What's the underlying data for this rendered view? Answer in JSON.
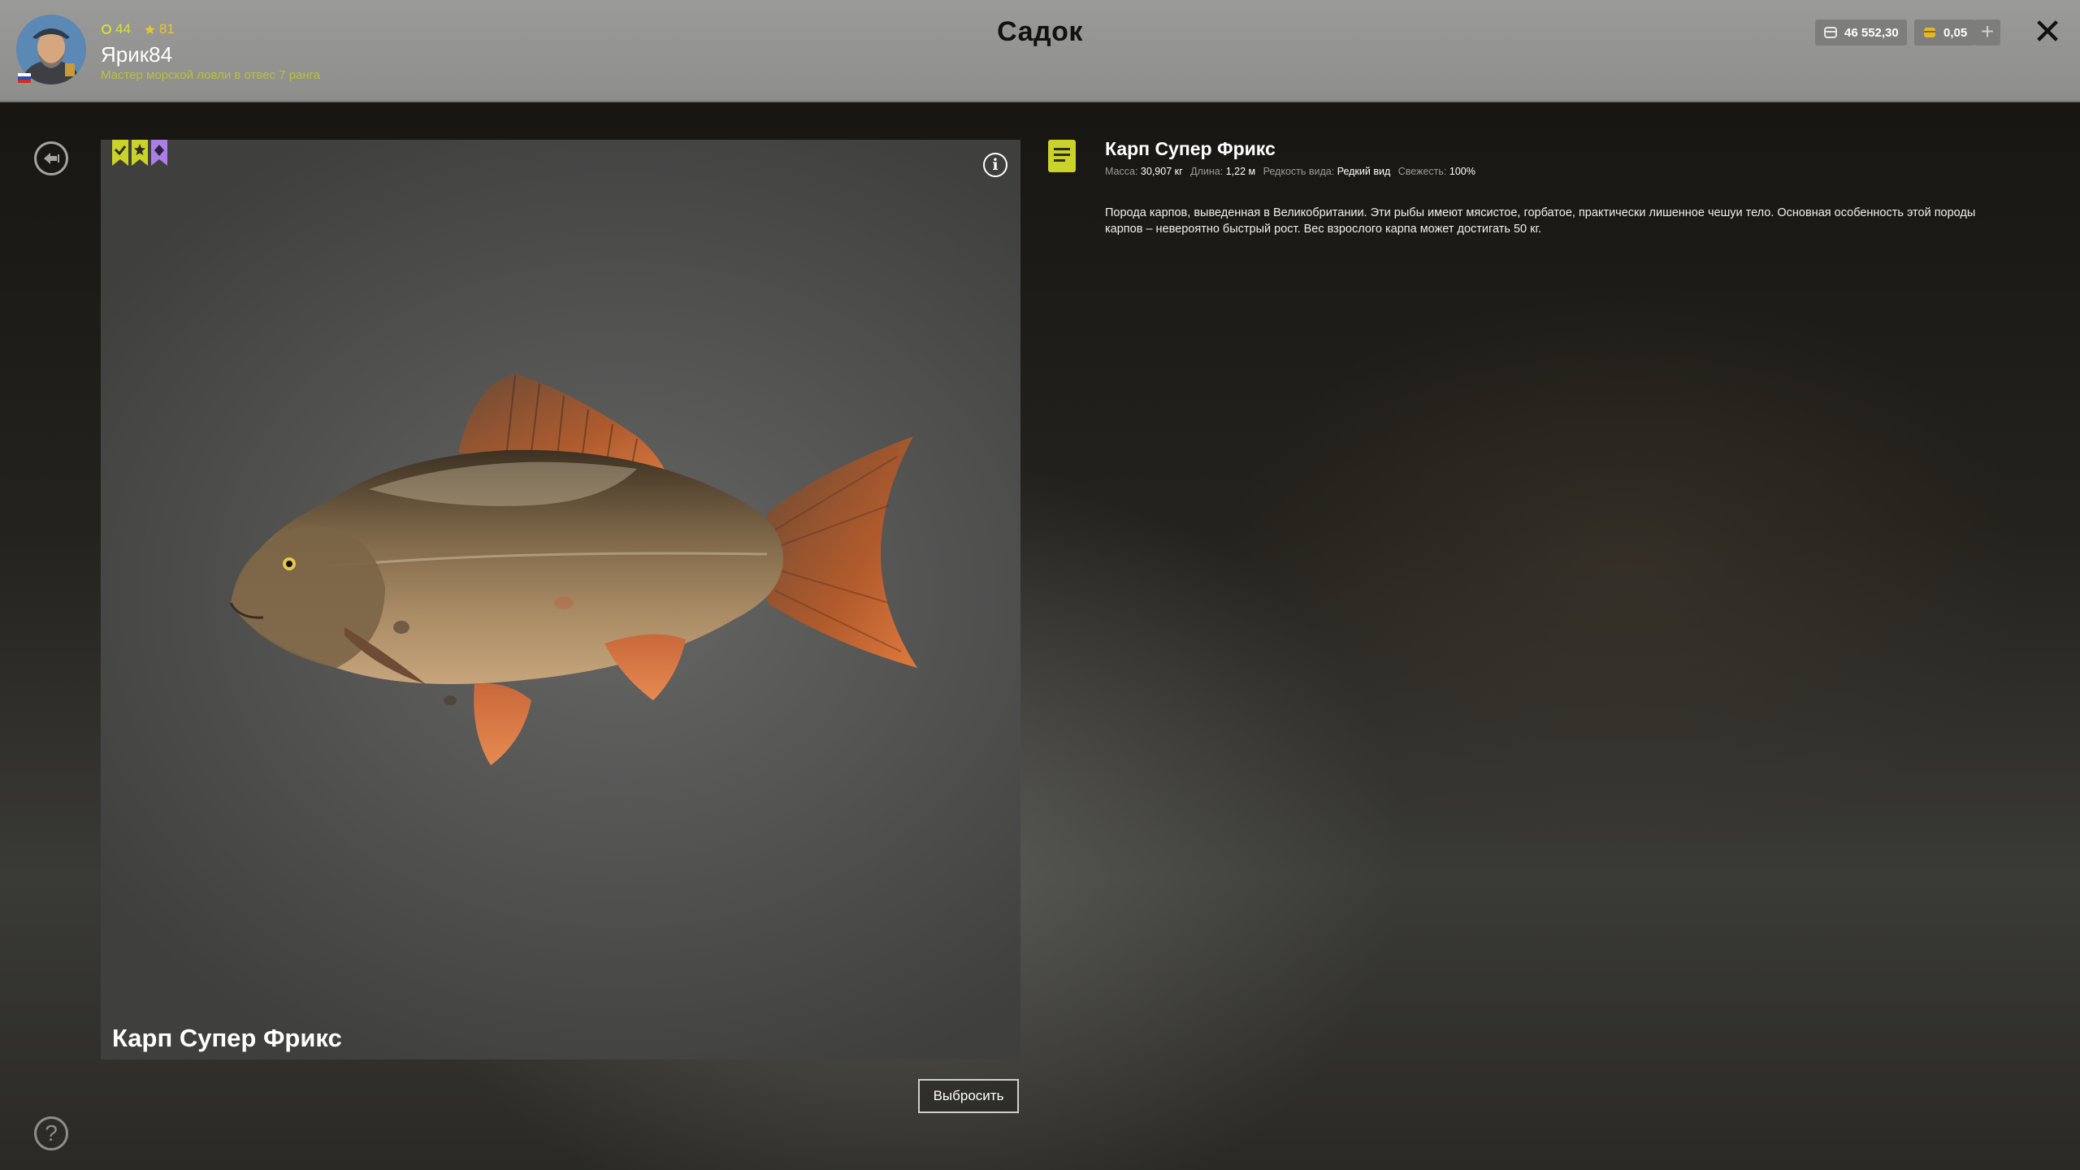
{
  "header": {
    "title": "Садок",
    "level": "44",
    "stars": "81",
    "username": "Ярик84",
    "rank": "Мастер морской ловли в отвес 7 ранга",
    "silver": "46 552,30",
    "gold": "0,05",
    "add": "+",
    "close": "✕"
  },
  "fish": {
    "name": "Карп Супер Фрикс",
    "info": "i",
    "badge_colors": [
      "#c9d329",
      "#c9d329",
      "#a97ee6"
    ]
  },
  "details": {
    "title": "Карп Супер Фрикс",
    "mass_label": "Масса:",
    "mass": "30,907 кг",
    "length_label": "Длина:",
    "length": "1,22 м",
    "rarity_label": "Редкость вида:",
    "rarity": "Редкий вид",
    "freshness_label": "Свежесть:",
    "freshness": "100%",
    "description": "Порода карпов, выведенная в Великобритании. Эти рыбы имеют мясистое, горбатое, практически лишенное чешуи тело. Основная особенность этой породы карпов – невероятно быстрый рост. Вес взрослого карпа может достигать 50 кг."
  },
  "actions": {
    "discard": "Выбросить",
    "help": "?"
  }
}
